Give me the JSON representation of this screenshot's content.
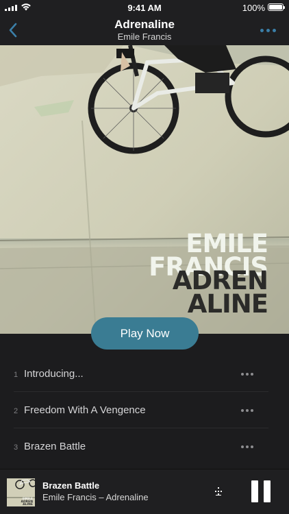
{
  "status_bar": {
    "time": "9:41 AM",
    "battery": "100%"
  },
  "nav": {
    "title": "Adrenaline",
    "subtitle": "Emile Francis",
    "back_icon": "chevron-left-icon",
    "more_icon": "more-horizontal-icon"
  },
  "album_art": {
    "artist_text": "EMILE\nFRANCIS",
    "album_text": "ADREN\nALINE",
    "artist_line1": "EMILE",
    "artist_line2": "FRANCIS",
    "album_line1": "ADREN",
    "album_line2": "ALINE"
  },
  "play_now_label": "Play Now",
  "tracks": [
    {
      "number": "1",
      "title": "Introducing..."
    },
    {
      "number": "2",
      "title": "Freedom With A Vengence"
    },
    {
      "number": "3",
      "title": "Brazen Battle"
    }
  ],
  "mini_player": {
    "title": "Brazen Battle",
    "subtitle": "Emile Francis – Adrenaline",
    "cast_icon": "cast-icon",
    "pause_icon": "pause-icon"
  },
  "colors": {
    "accent": "#3a7c93",
    "nav_icon": "#3b7fa8",
    "background": "#1c1c1e"
  }
}
